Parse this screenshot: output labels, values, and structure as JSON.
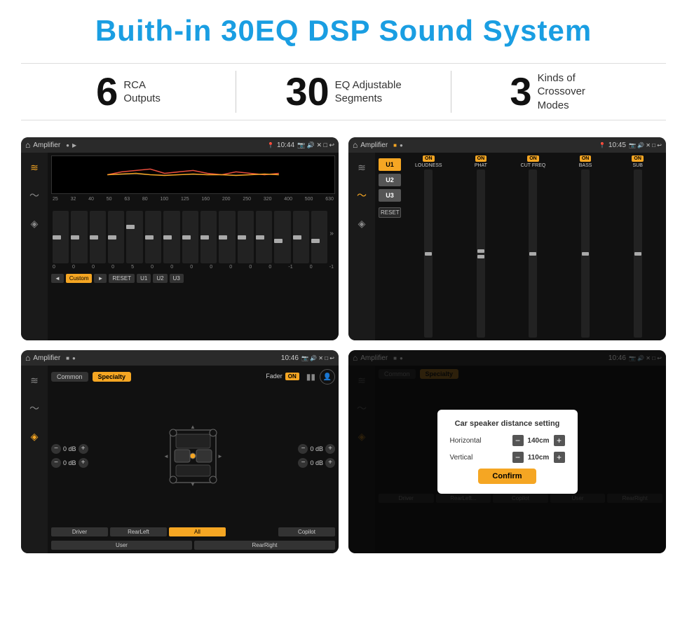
{
  "page": {
    "title": "Buith-in 30EQ DSP Sound System",
    "stats": [
      {
        "number": "6",
        "text": "RCA\nOutputs"
      },
      {
        "number": "30",
        "text": "EQ Adjustable\nSegments"
      },
      {
        "number": "3",
        "text": "Kinds of\nCrossover Modes"
      }
    ],
    "screens": [
      {
        "id": "eq-screen",
        "statusBar": {
          "appName": "Amplifier",
          "time": "10:44"
        },
        "type": "equalizer"
      },
      {
        "id": "dsp-screen",
        "statusBar": {
          "appName": "Amplifier",
          "time": "10:45"
        },
        "type": "dsp"
      },
      {
        "id": "fader-screen",
        "statusBar": {
          "appName": "Amplifier",
          "time": "10:46"
        },
        "type": "fader"
      },
      {
        "id": "dialog-screen",
        "statusBar": {
          "appName": "Amplifier",
          "time": "10:46"
        },
        "type": "dialog",
        "dialog": {
          "title": "Car speaker distance setting",
          "horizontal": "140cm",
          "vertical": "110cm",
          "confirmLabel": "Confirm"
        }
      }
    ],
    "eq": {
      "frequencies": [
        "25",
        "32",
        "40",
        "50",
        "63",
        "80",
        "100",
        "125",
        "160",
        "200",
        "250",
        "320",
        "400",
        "500",
        "630"
      ],
      "values": [
        "0",
        "0",
        "0",
        "0",
        "5",
        "0",
        "0",
        "0",
        "0",
        "0",
        "0",
        "0",
        "-1",
        "0",
        "-1"
      ],
      "modes": [
        "Custom",
        "RESET",
        "U1",
        "U2",
        "U3"
      ]
    },
    "dsp": {
      "presets": [
        "U1",
        "U2",
        "U3"
      ],
      "channels": [
        "LOUDNESS",
        "PHAT",
        "CUT FREQ",
        "BASS",
        "SUB"
      ],
      "resetLabel": "RESET"
    },
    "fader": {
      "tabs": [
        "Common",
        "Specialty"
      ],
      "faderLabel": "Fader",
      "onLabel": "ON",
      "dbValues": [
        "0 dB",
        "0 dB",
        "0 dB",
        "0 dB"
      ],
      "bottomBtns": [
        "Driver",
        "RearLeft",
        "All",
        "Copilot",
        "RearRight",
        "User"
      ]
    }
  }
}
